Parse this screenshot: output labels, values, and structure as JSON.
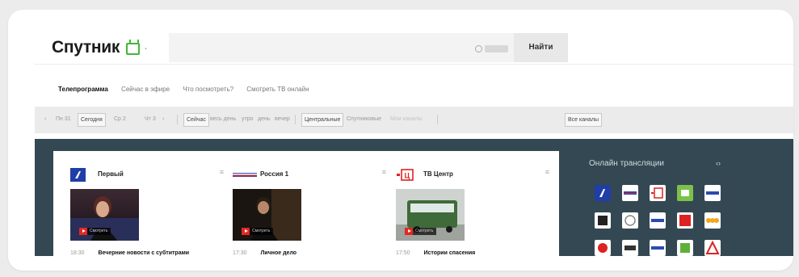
{
  "header": {
    "logo_text": "Спутник",
    "logo_suffix": "·",
    "search_button": "Найти",
    "search_placeholder": ""
  },
  "nav": {
    "items": [
      "Телепрограмма",
      "Сейчас в эфире",
      "Что посмотреть?",
      "Смотреть ТВ онлайн"
    ]
  },
  "filters": {
    "prev_arrow": "‹",
    "days": [
      "Пн 31",
      "Сегодня",
      "Ср 2",
      "Чт 3"
    ],
    "next_arrow": "›",
    "times": [
      "Сейчас",
      "весь день",
      "утро",
      "день",
      "вечер"
    ],
    "regions": [
      "Центральные",
      "Спутниковые",
      "Мои каналы"
    ],
    "all_channels": "Все каналы"
  },
  "channels": [
    {
      "name": "Первый",
      "time": "18:30",
      "program": "Вечерние новости с субтитрами",
      "watch": "Смотреть"
    },
    {
      "name": "Россия 1",
      "time": "17:30",
      "program": "Личное дело",
      "watch": "Смотреть"
    },
    {
      "name": "ТВ Центр",
      "time": "17:50",
      "program": "Истории спасения",
      "watch": "Смотреть"
    }
  ],
  "online": {
    "title": "Онлайн трансляции",
    "arrows": "‹›"
  },
  "colors": {
    "dark_bg": "#334852",
    "accent_green": "#46b43c",
    "play_red": "#e52620"
  }
}
